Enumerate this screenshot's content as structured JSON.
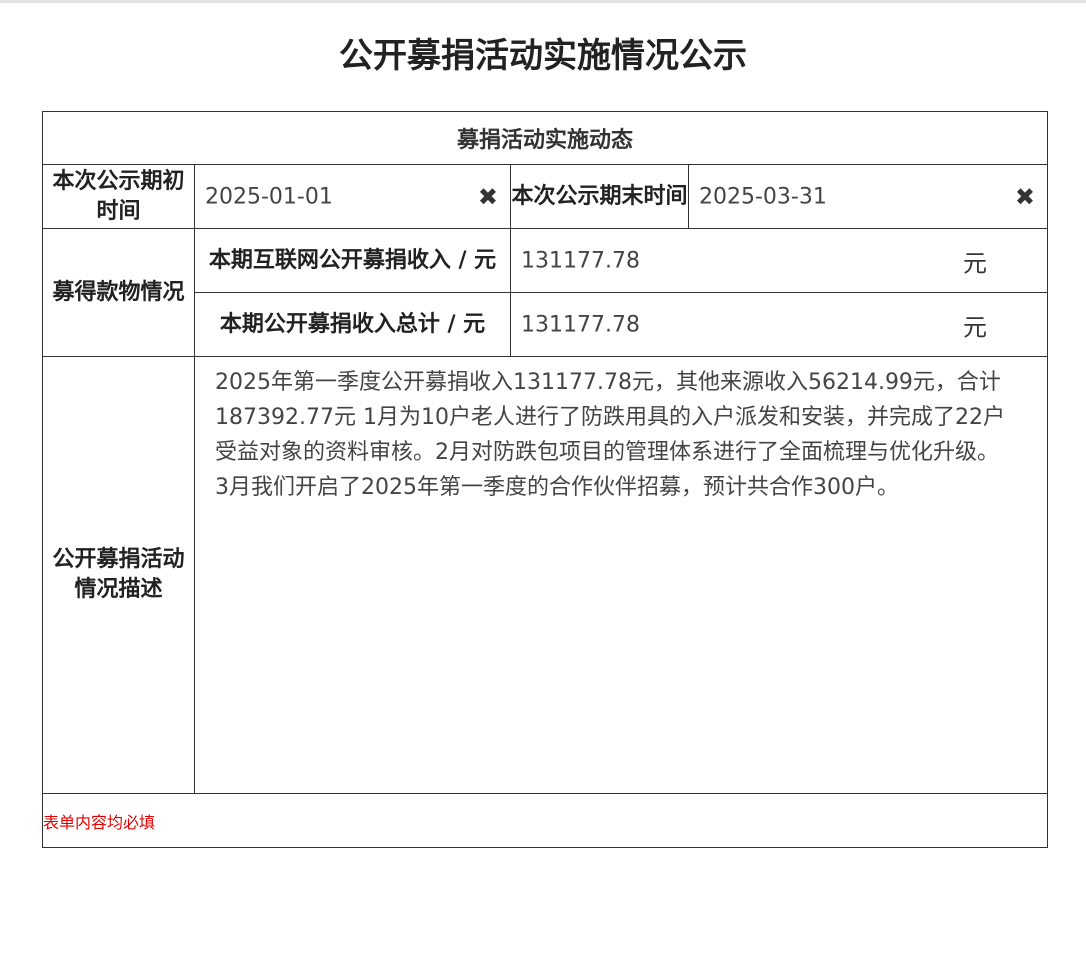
{
  "page": {
    "title": "公开募捐活动实施情况公示"
  },
  "form": {
    "section_title": "募捐活动实施动态",
    "start_label": "本次公示期初时间",
    "start_value": "2025-01-01",
    "end_label": "本次公示期末时间",
    "end_value": "2025-03-31",
    "clear_icon_glyph": "✖",
    "funds_label": "募得款物情况",
    "internet_income_label": "本期互联网公开募捐收入 / 元",
    "internet_income_value": "131177.78",
    "internet_income_unit": "元",
    "total_income_label": "本期公开募捐收入总计 / 元",
    "total_income_value": "131177.78",
    "total_income_unit": "元",
    "description_label": "公开募捐活动情况描述",
    "description_value": "2025年第一季度公开募捐收入131177.78元，其他来源收入56214.99元，合计187392.77元 1月为10户老人进行了防跌用具的入户派发和安装，并完成了22户受益对象的资料审核。2月对防跌包项目的管理体系进行了全面梳理与优化升级。3月我们开启了2025年第一季度的合作伙伴招募，预计共合作300户。",
    "required_note": "表单内容均必填"
  },
  "icons": {
    "clear": "clear-x-icon"
  },
  "colors": {
    "border": "#333333",
    "required_note": "#e00000",
    "top_bar": "#e3e3e3"
  }
}
